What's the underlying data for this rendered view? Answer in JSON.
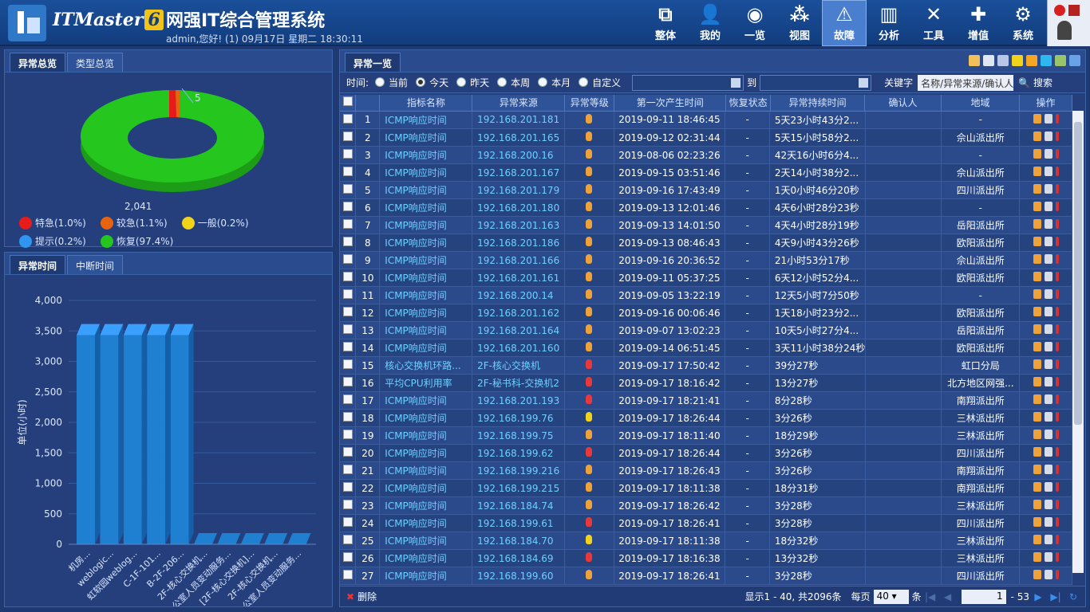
{
  "app": {
    "brand": "ITMaster",
    "brand_version": "6",
    "title": "网强IT综合管理系统",
    "user_line": "admin,您好! (1) 09月17日 星期二 18:30:11"
  },
  "nav": [
    {
      "label": "整体",
      "icon": "layers-icon",
      "glyph": "⧉"
    },
    {
      "label": "我的",
      "icon": "user-icon",
      "glyph": "👤"
    },
    {
      "label": "一览",
      "icon": "globe-icon",
      "glyph": "◉"
    },
    {
      "label": "视图",
      "icon": "topology-icon",
      "glyph": "⁂"
    },
    {
      "label": "故障",
      "icon": "warning-icon",
      "glyph": "⚠"
    },
    {
      "label": "分析",
      "icon": "bar-chart-icon",
      "glyph": "▥"
    },
    {
      "label": "工具",
      "icon": "tools-icon",
      "glyph": "✕"
    },
    {
      "label": "增值",
      "icon": "plus-icon",
      "glyph": "✚"
    },
    {
      "label": "系统",
      "icon": "gear-icon",
      "glyph": "⚙"
    }
  ],
  "active_nav": 4,
  "left_top": {
    "tabs": [
      "异常总览",
      "类型总览"
    ],
    "active_tab": 0,
    "donut_label_top": "5",
    "donut_label_bottom": "2,041",
    "legend": [
      {
        "label": "特急(1.0%)",
        "color": "#e81b1b"
      },
      {
        "label": "较急(1.1%)",
        "color": "#e8630f"
      },
      {
        "label": "一般(0.2%)",
        "color": "#f2d31b"
      },
      {
        "label": "提示(0.2%)",
        "color": "#2f95f0"
      },
      {
        "label": "恢复(97.4%)",
        "color": "#25c71f"
      }
    ]
  },
  "left_bottom": {
    "tabs": [
      "异常时间",
      "中断时间"
    ],
    "active_tab": 0
  },
  "chart_data": {
    "type": "bar",
    "ylabel": "单位(小时)",
    "ylim": [
      0,
      4000
    ],
    "yticks": [
      "4,000",
      "3,500",
      "3,000",
      "2,500",
      "2,000",
      "1,500",
      "1,000",
      "500",
      "0"
    ],
    "categories": [
      "机房...",
      "weblogic...",
      "虹软园weblog...",
      "C-1F-101...",
      "B-2F-206...",
      "2F-核心交换机...",
      "[办公室人员变动服务...",
      "[2F-核心交换机]...",
      "2F-核心交换机...",
      "[办公室人员变动服务..."
    ],
    "values": [
      3430,
      3430,
      3430,
      3430,
      3430,
      0,
      0,
      0,
      0,
      0
    ]
  },
  "main": {
    "tab": "异常一览",
    "filter": {
      "time_label": "时间:",
      "options": [
        "当前",
        "今天",
        "昨天",
        "本周",
        "本月",
        "自定义"
      ],
      "selected": 1,
      "to_label": "到",
      "keyword_label": "关键字",
      "keyword_placeholder": "名称/异常来源/确认人",
      "search_label": "搜索"
    },
    "columns": [
      "指标名称",
      "异常来源",
      "异常等级",
      "第一次产生时间",
      "恢复状态",
      "异常持续时间",
      "确认人",
      "地域",
      "操作"
    ],
    "rows": [
      {
        "n": "1",
        "name": "ICMP响应时间",
        "src": "192.168.201.181",
        "lvl": "#f0a23a",
        "time": "2019-09-11 18:46:45",
        "rec": "-",
        "dur": "5天23小时43分2...",
        "area": "-"
      },
      {
        "n": "2",
        "name": "ICMP响应时间",
        "src": "192.168.201.165",
        "lvl": "#f0a23a",
        "time": "2019-09-12 02:31:44",
        "rec": "-",
        "dur": "5天15小时58分2...",
        "area": "佘山派出所"
      },
      {
        "n": "3",
        "name": "ICMP响应时间",
        "src": "192.168.200.16",
        "lvl": "#f0a23a",
        "time": "2019-08-06 02:23:26",
        "rec": "-",
        "dur": "42天16小时6分4...",
        "area": "-"
      },
      {
        "n": "4",
        "name": "ICMP响应时间",
        "src": "192.168.201.167",
        "lvl": "#f0a23a",
        "time": "2019-09-15 03:51:46",
        "rec": "-",
        "dur": "2天14小时38分2...",
        "area": "佘山派出所"
      },
      {
        "n": "5",
        "name": "ICMP响应时间",
        "src": "192.168.201.179",
        "lvl": "#f0a23a",
        "time": "2019-09-16 17:43:49",
        "rec": "-",
        "dur": "1天0小时46分20秒",
        "area": "四川派出所"
      },
      {
        "n": "6",
        "name": "ICMP响应时间",
        "src": "192.168.201.180",
        "lvl": "#f0a23a",
        "time": "2019-09-13 12:01:46",
        "rec": "-",
        "dur": "4天6小时28分23秒",
        "area": "-"
      },
      {
        "n": "7",
        "name": "ICMP响应时间",
        "src": "192.168.201.163",
        "lvl": "#f0a23a",
        "time": "2019-09-13 14:01:50",
        "rec": "-",
        "dur": "4天4小时28分19秒",
        "area": "岳阳派出所"
      },
      {
        "n": "8",
        "name": "ICMP响应时间",
        "src": "192.168.201.186",
        "lvl": "#f0a23a",
        "time": "2019-09-13 08:46:43",
        "rec": "-",
        "dur": "4天9小时43分26秒",
        "area": "欧阳派出所"
      },
      {
        "n": "9",
        "name": "ICMP响应时间",
        "src": "192.168.201.166",
        "lvl": "#f0a23a",
        "time": "2019-09-16 20:36:52",
        "rec": "-",
        "dur": "21小时53分17秒",
        "area": "佘山派出所"
      },
      {
        "n": "10",
        "name": "ICMP响应时间",
        "src": "192.168.201.161",
        "lvl": "#f0a23a",
        "time": "2019-09-11 05:37:25",
        "rec": "-",
        "dur": "6天12小时52分4...",
        "area": "欧阳派出所"
      },
      {
        "n": "11",
        "name": "ICMP响应时间",
        "src": "192.168.200.14",
        "lvl": "#f0a23a",
        "time": "2019-09-05 13:22:19",
        "rec": "-",
        "dur": "12天5小时7分50秒",
        "area": "-"
      },
      {
        "n": "12",
        "name": "ICMP响应时间",
        "src": "192.168.201.162",
        "lvl": "#f0a23a",
        "time": "2019-09-16 00:06:46",
        "rec": "-",
        "dur": "1天18小时23分2...",
        "area": "欧阳派出所"
      },
      {
        "n": "13",
        "name": "ICMP响应时间",
        "src": "192.168.201.164",
        "lvl": "#f0a23a",
        "time": "2019-09-07 13:02:23",
        "rec": "-",
        "dur": "10天5小时27分4...",
        "area": "岳阳派出所"
      },
      {
        "n": "14",
        "name": "ICMP响应时间",
        "src": "192.168.201.160",
        "lvl": "#f0a23a",
        "time": "2019-09-14 06:51:45",
        "rec": "-",
        "dur": "3天11小时38分24秒",
        "area": "欧阳派出所"
      },
      {
        "n": "15",
        "name": "核心交换机环路...",
        "src": "2F-核心交换机",
        "lvl": "#e8383a",
        "time": "2019-09-17 17:50:42",
        "rec": "-",
        "dur": "39分27秒",
        "area": "虹口分局"
      },
      {
        "n": "16",
        "name": "平均CPU利用率",
        "src": "2F-秘书科-交换机2",
        "lvl": "#e8383a",
        "time": "2019-09-17 18:16:42",
        "rec": "-",
        "dur": "13分27秒",
        "area": "北方地区网强..."
      },
      {
        "n": "17",
        "name": "ICMP响应时间",
        "src": "192.168.201.193",
        "lvl": "#e8383a",
        "time": "2019-09-17 18:21:41",
        "rec": "-",
        "dur": "8分28秒",
        "area": "南翔派出所"
      },
      {
        "n": "18",
        "name": "ICMP响应时间",
        "src": "192.168.199.76",
        "lvl": "#f2d31b",
        "time": "2019-09-17 18:26:44",
        "rec": "-",
        "dur": "3分26秒",
        "area": "三林派出所"
      },
      {
        "n": "19",
        "name": "ICMP响应时间",
        "src": "192.168.199.75",
        "lvl": "#f0a23a",
        "time": "2019-09-17 18:11:40",
        "rec": "-",
        "dur": "18分29秒",
        "area": "三林派出所"
      },
      {
        "n": "20",
        "name": "ICMP响应时间",
        "src": "192.168.199.62",
        "lvl": "#e8383a",
        "time": "2019-09-17 18:26:44",
        "rec": "-",
        "dur": "3分26秒",
        "area": "四川派出所"
      },
      {
        "n": "21",
        "name": "ICMP响应时间",
        "src": "192.168.199.216",
        "lvl": "#f0a23a",
        "time": "2019-09-17 18:26:43",
        "rec": "-",
        "dur": "3分26秒",
        "area": "南翔派出所"
      },
      {
        "n": "22",
        "name": "ICMP响应时间",
        "src": "192.168.199.215",
        "lvl": "#f0a23a",
        "time": "2019-09-17 18:11:38",
        "rec": "-",
        "dur": "18分31秒",
        "area": "南翔派出所"
      },
      {
        "n": "23",
        "name": "ICMP响应时间",
        "src": "192.168.184.74",
        "lvl": "#f0a23a",
        "time": "2019-09-17 18:26:42",
        "rec": "-",
        "dur": "3分28秒",
        "area": "三林派出所"
      },
      {
        "n": "24",
        "name": "ICMP响应时间",
        "src": "192.168.199.61",
        "lvl": "#e8383a",
        "time": "2019-09-17 18:26:41",
        "rec": "-",
        "dur": "3分28秒",
        "area": "四川派出所"
      },
      {
        "n": "25",
        "name": "ICMP响应时间",
        "src": "192.168.184.70",
        "lvl": "#f2d31b",
        "time": "2019-09-17 18:11:38",
        "rec": "-",
        "dur": "18分32秒",
        "area": "三林派出所"
      },
      {
        "n": "26",
        "name": "ICMP响应时间",
        "src": "192.168.184.69",
        "lvl": "#e8383a",
        "time": "2019-09-17 18:16:38",
        "rec": "-",
        "dur": "13分32秒",
        "area": "三林派出所"
      },
      {
        "n": "27",
        "name": "ICMP响应时间",
        "src": "192.168.199.60",
        "lvl": "#f0a23a",
        "time": "2019-09-17 18:26:41",
        "rec": "-",
        "dur": "3分28秒",
        "area": "四川派出所"
      }
    ],
    "footer": {
      "delete_label": "删除",
      "summary": "显示1 - 40, 共2096条",
      "per_page_label": "每页",
      "per_page": "40",
      "per_page_unit": "条",
      "page_input": "1",
      "total_pages": "- 53"
    }
  }
}
